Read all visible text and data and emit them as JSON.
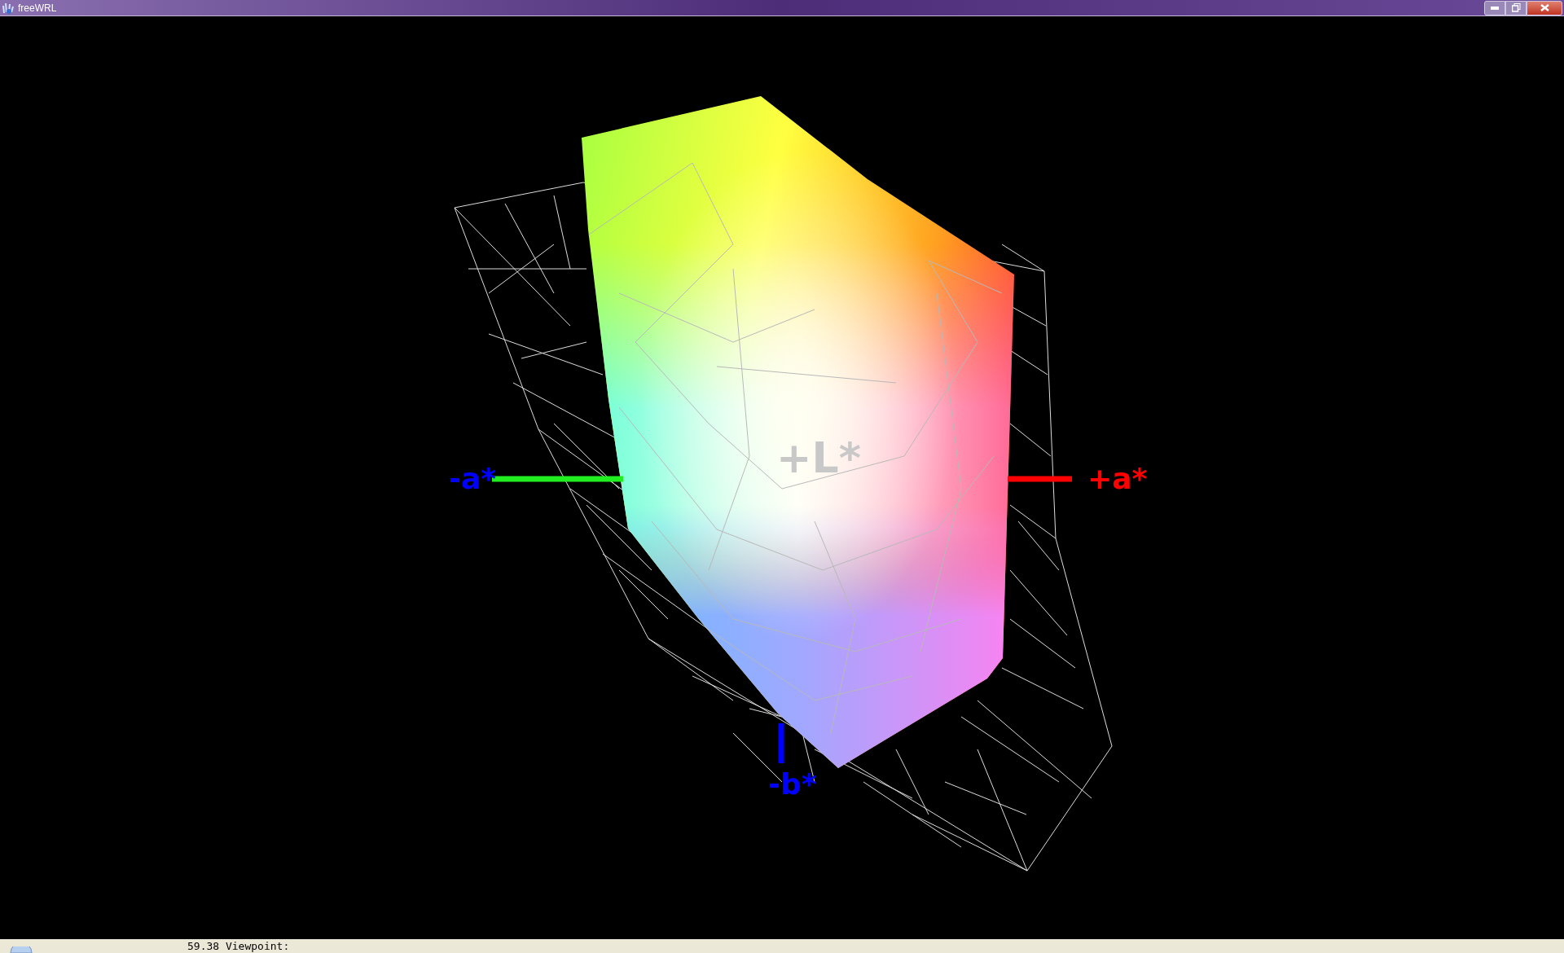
{
  "window": {
    "title": "freeWRL"
  },
  "axis_labels": [
    {
      "kind": "neg_a",
      "label": "-a*"
    },
    {
      "kind": "pos_a",
      "label": "+a*"
    },
    {
      "kind": "neg_b",
      "label": "-b*"
    },
    {
      "kind": "pos_l",
      "label": "+L*"
    }
  ],
  "status_bar": {
    "text": "59.38 Viewpoint:"
  }
}
